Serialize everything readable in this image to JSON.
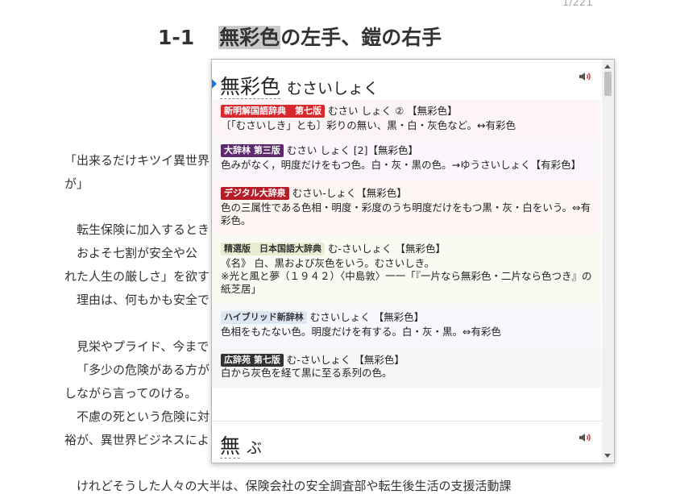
{
  "page_counter": "1/221",
  "chapter": {
    "number": "1-1",
    "highlighted": "無彩色",
    "rest": "の左手、鎧の右手"
  },
  "body_lines": [
    "「出来るだけキツイ異世界",
    "が」",
    "転生保険に加入するとき",
    "およそ七割が安全や公",
    "れた人生の厳しさ」を欲す",
    "理由は、何もかも安全で",
    "見栄やプライド、今まで",
    "「多少の危険がある方が",
    "しながら言ってのける。",
    "不慮の死という危険に対",
    "裕が、異世界ビジネスによ",
    "けれどそうした人々の大半は、保険会社の安全調査部や転生後生活の支援活動課"
  ],
  "popup": {
    "entry1": {
      "headword": "無彩色",
      "reading": "むさいしょく",
      "speaker_icon": "speaker-icon",
      "definitions": [
        {
          "source": "新明解国語辞典　第七版",
          "badge_bg": "#d9272e",
          "badge_fg": "#ffffff",
          "row_bg": "#fdf5f5",
          "head": "むさい しょく ② 【無彩色】",
          "body": "〔「むさいしき」とも〕彩りの無い、黒・白・灰色など。↔有彩色"
        },
        {
          "source": "大辞林 第三版",
          "badge_bg": "#5e2a6e",
          "badge_fg": "#ffffff",
          "row_bg": "#faf6fb",
          "head": "むさい しょく [2]【無彩色】",
          "body": "色みがなく，明度だけをもつ色。白・灰・黒の色。→ゆうさいしょく【有彩色】"
        },
        {
          "source": "デジタル大辞泉",
          "badge_bg": "#b51d28",
          "badge_fg": "#ffffff",
          "row_bg": "#fdf4f4",
          "head": "むさい‐しょく【無彩色】",
          "body": "色の三属性である色相・明度・彩度のうち明度だけをもつ黒・灰・白をいう。⇔有彩色。"
        },
        {
          "source": "精選版　日本国語大辞典",
          "badge_bg": "#e8ecd0",
          "badge_fg": "#333333",
          "row_bg": "#f9faf2",
          "head": "む‐さいしょく 【無彩色】",
          "body": "《名》 白、黒および灰色をいう。むさいしき。\n※光と風と夢（１９４２）〈中島敦〉一一「『一片なら無彩色・二片なら色つき』の紙芝居」"
        },
        {
          "source": "ハイブリッド新辞林",
          "badge_bg": "#dde6f3",
          "badge_fg": "#333333",
          "row_bg": "#f6f8fc",
          "head": "むさいしょく 【無彩色】",
          "body": "色相をもたない色。明度だけを有する。白・灰・黒。⇔有彩色"
        },
        {
          "source": "広辞苑 第七版",
          "badge_bg": "#333333",
          "badge_fg": "#ffffff",
          "row_bg": "#f6f6f6",
          "head": "む‐さいしょく 【無彩色】",
          "body": "白から灰色を経て黒に至る系列の色。"
        }
      ]
    },
    "entry2": {
      "headword": "無",
      "reading": "ぶ",
      "speaker_icon": "speaker-icon"
    }
  }
}
